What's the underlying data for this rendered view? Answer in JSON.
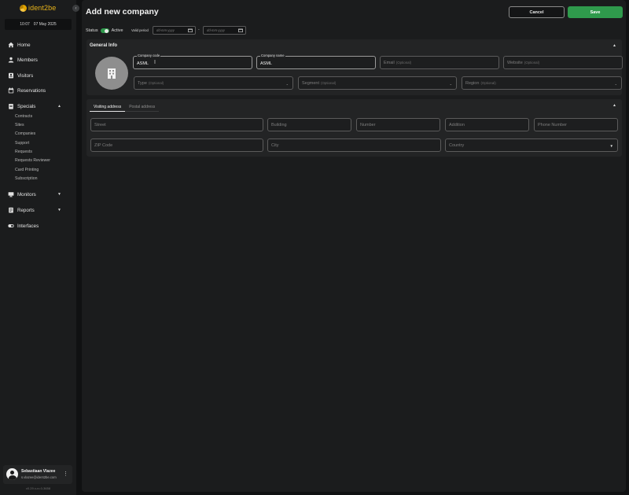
{
  "sidebar": {
    "logo_text": "ident2be",
    "clock": {
      "time": "10:07",
      "date": "07 May 2025"
    },
    "nav": [
      {
        "label": "Home",
        "icon": "home-icon"
      },
      {
        "label": "Members",
        "icon": "person-icon"
      },
      {
        "label": "Visitors",
        "icon": "badge-icon"
      },
      {
        "label": "Reservations",
        "icon": "calendar-icon"
      },
      {
        "label": "Specials",
        "icon": "clipboard-icon",
        "expanded": true
      },
      {
        "label": "Monitors",
        "icon": "monitor-icon"
      },
      {
        "label": "Reports",
        "icon": "report-icon"
      },
      {
        "label": "Interfaces",
        "icon": "toggle-icon"
      }
    ],
    "specials_items": [
      "Contracts",
      "Sites",
      "Companies",
      "Support",
      "Requests",
      "Requests Reviewer",
      "Card Printing",
      "Subscription"
    ],
    "user": {
      "name": "Sebastiaan Vlazee",
      "email": "s.vlazee@ident2be.com"
    },
    "version": "v0.29.x-rc.0-3658"
  },
  "header": {
    "title": "Add new company",
    "cancel_label": "Cancel",
    "save_label": "Save"
  },
  "status": {
    "label": "Status",
    "value": "Active",
    "active": true,
    "valid_period_label": "Valid period",
    "date_from_placeholder": "dd-mm-yyyy",
    "date_to_placeholder": "dd-mm-yyyy",
    "separator": "-"
  },
  "general_info": {
    "title": "General Info",
    "company_code": {
      "label": "Company code",
      "value": "ASML"
    },
    "company_name": {
      "label": "Company name",
      "value": "ASML"
    },
    "email": {
      "placeholder": "Email",
      "optional": "(Optional)"
    },
    "website": {
      "placeholder": "Website",
      "optional": "(Optional)"
    },
    "type": {
      "placeholder": "Type",
      "optional": "(Optional)"
    },
    "segment": {
      "placeholder": "Segment",
      "optional": "(Optional)"
    },
    "region": {
      "placeholder": "Region",
      "optional": "(Optional)"
    }
  },
  "address": {
    "tabs": [
      "Visiting address",
      "Postal address"
    ],
    "active_tab": 0,
    "fields": {
      "street": "Street",
      "building": "Building",
      "number": "Number",
      "addition": "Addition",
      "phone": "Phone Number",
      "zip": "ZIP Code",
      "city": "City",
      "country": "Country"
    }
  },
  "colors": {
    "accent": "#2f9a4c",
    "background": "#101112",
    "panel": "#1b1c1d",
    "brand": "#e6b21a"
  }
}
